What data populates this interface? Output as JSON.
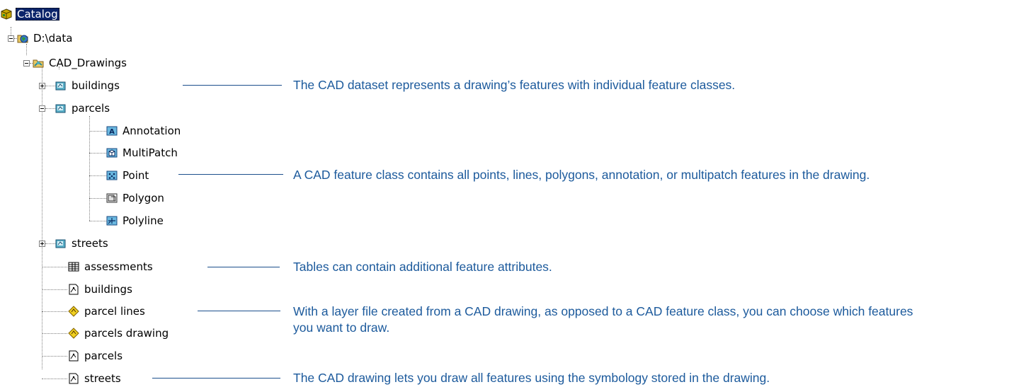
{
  "tree": {
    "catalog": "Catalog",
    "drive": "D:\\data",
    "cad_drawings": "CAD_Drawings",
    "buildings_dataset": "buildings",
    "parcels_dataset": "parcels",
    "annotation": "Annotation",
    "multipatch": "MultiPatch",
    "point": "Point",
    "polygon": "Polygon",
    "polyline": "Polyline",
    "streets_dataset": "streets",
    "assessments": "assessments",
    "buildings_drawing": "buildings",
    "parcel_lines": "parcel lines",
    "parcels_drawing_layer": "parcels drawing",
    "parcels_drawing": "parcels",
    "streets_drawing": "streets"
  },
  "callouts": {
    "dataset": "The CAD dataset represents a drawing’s features with individual feature classes.",
    "feature_class": "A CAD feature class contains all points, lines, polygons, annotation, or multipatch features in the drawing.",
    "tables": "Tables can contain additional feature attributes.",
    "layer_file": "With a layer file created from a CAD drawing, as opposed to a CAD feature class, you can choose which features you want to draw.",
    "cad_drawing": "The CAD drawing lets you draw all features using the symbology stored in the drawing."
  },
  "colors": {
    "callout_text": "#1c5a9c",
    "callout_line": "#1c4f8c",
    "selection": "#0a246a"
  },
  "icons": {
    "catalog": "catalog-icon",
    "drive": "globe-folder-icon",
    "cad_dataset": "cad-dataset-icon",
    "annotation": "annotation-feature-class-icon",
    "multipatch": "multipatch-feature-class-icon",
    "point": "point-feature-class-icon",
    "polygon": "polygon-feature-class-icon",
    "polyline": "polyline-feature-class-icon",
    "table": "table-icon",
    "cad_drawing": "cad-drawing-icon",
    "layer": "layer-file-icon"
  }
}
